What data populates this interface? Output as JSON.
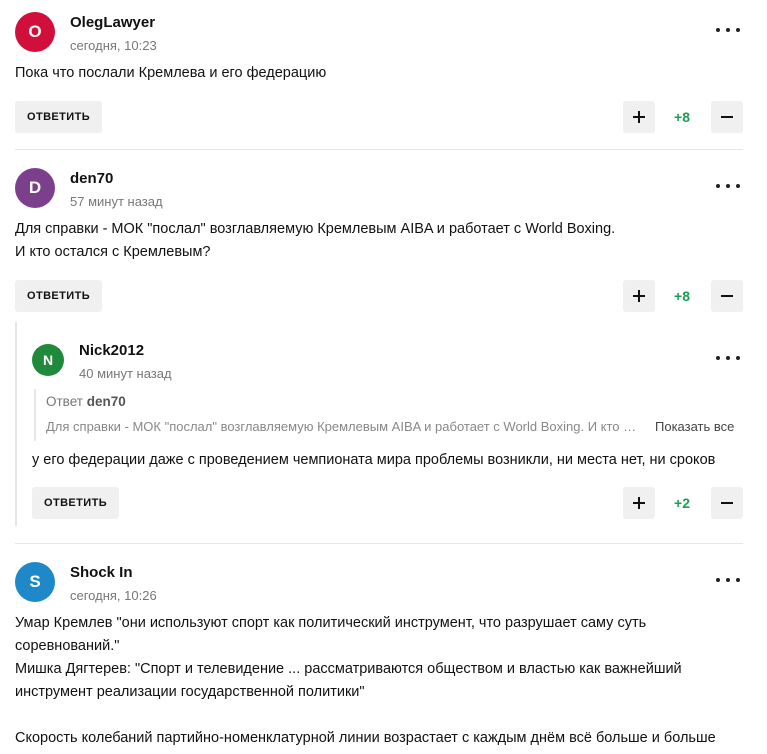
{
  "reply_label": "ОТВЕТИТЬ",
  "comments": [
    {
      "avatar_letter": "O",
      "avatar_color": "#d0103a",
      "author": "OlegLawyer",
      "time": "сегодня, 10:23",
      "text": "Пока что послали Кремлева и его федерацию",
      "score": "+8"
    },
    {
      "avatar_letter": "D",
      "avatar_color": "#7b3f8c",
      "author": "den70",
      "time": "57 минут назад",
      "text": "Для справки - МОК \"послал\" возглавляемую Кремлевым AIBA и работает с World Boxing.\nИ кто остался с Кремлевым?",
      "score": "+8"
    },
    {
      "avatar_letter": "N",
      "avatar_color": "#1f8a3b",
      "author": "Nick2012",
      "time": "40 минут назад",
      "quote_prefix": "Ответ",
      "quote_author": "den70",
      "quote_text": "Для справки - МОК \"послал\" возглавляемую Кремлевым AIBA и работает с World Boxing. И кто остался с Кремлевым?",
      "show_all": "Показать все",
      "text": "у его федерации даже с проведением чемпионата мира проблемы возникли, ни места нет, ни сроков",
      "score": "+2"
    },
    {
      "avatar_letter": "S",
      "avatar_color": "#1e88c9",
      "author": "Shock In",
      "time": "сегодня, 10:26",
      "text": "Умар Кремлев \"они используют спорт как политический инструмент, что разрушает саму суть\nсоревнований.\"\nМишка Дягтерев: \"Спорт и телевидение ... рассматриваются обществом и властью как важнейший\nинструмент реализации государственной политики\"\n\nСкорость колебаний партийно-номенклатурной линии возрастает с каждым днём всё больше и больше"
    }
  ]
}
